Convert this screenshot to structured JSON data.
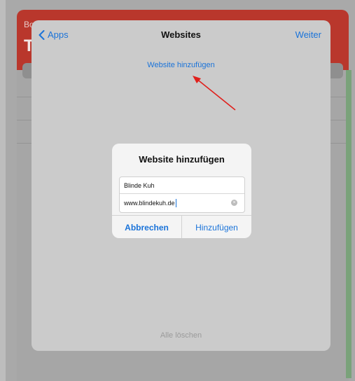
{
  "background": {
    "title_small": "Bo...",
    "title_large": "T"
  },
  "nav": {
    "back_label": "Apps",
    "title": "Websites",
    "next_label": "Weiter"
  },
  "sheet": {
    "add_link": "Website hinzufügen",
    "clear_all": "Alle löschen"
  },
  "dialog": {
    "title": "Website hinzufügen",
    "name_value": "Blinde Kuh",
    "url_value": "www.blindekuh.de",
    "cancel_label": "Abbrechen",
    "add_label": "Hinzufügen"
  },
  "colors": {
    "accent": "#1a73d9",
    "annotation_arrow": "#e0201c",
    "header_red": "#b9372c"
  }
}
